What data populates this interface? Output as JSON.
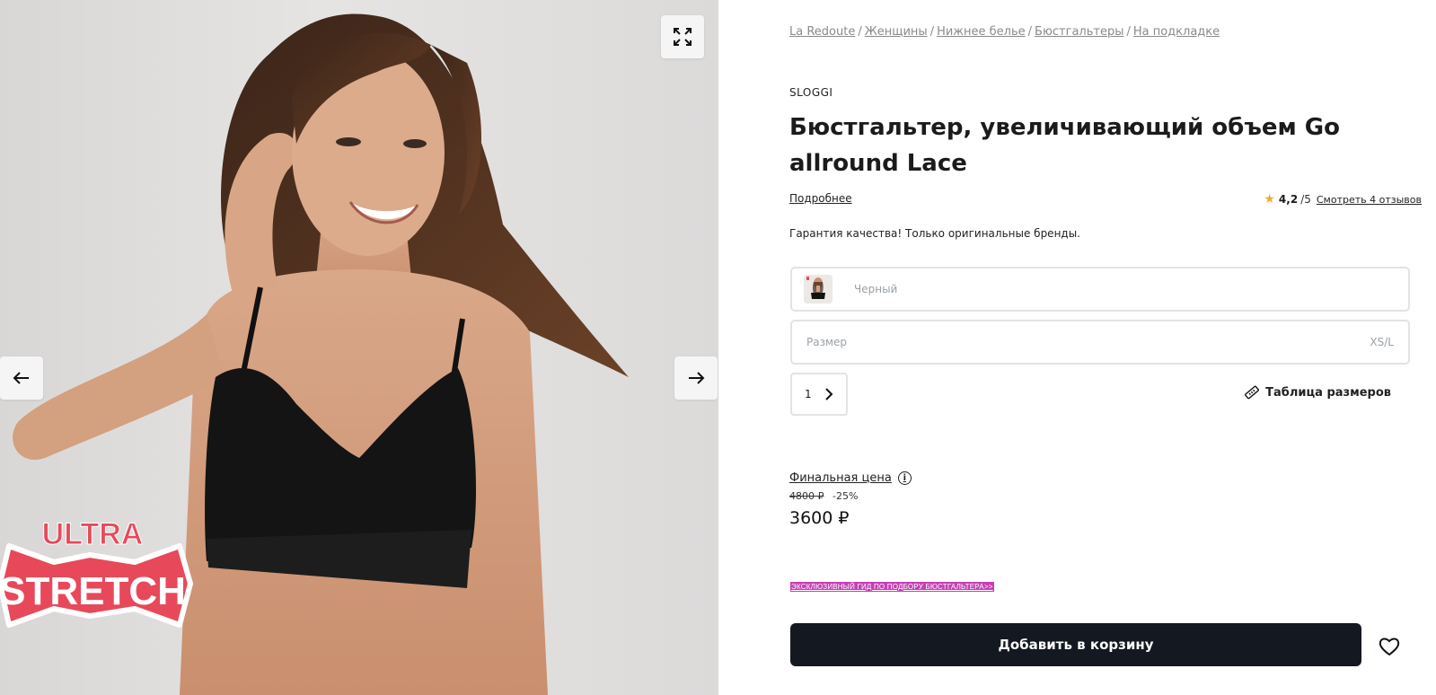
{
  "gallery": {
    "fullscreen_icon": "expand-icon",
    "prev_icon": "arrow-left-icon",
    "next_icon": "arrow-right-icon",
    "badge_line1": "ULTRA",
    "badge_line2": "STRETCH"
  },
  "breadcrumb": {
    "items": [
      "La Redoute",
      "Женщины",
      "Нижнее белье",
      "Бюстгальтеры",
      "На подкладке"
    ],
    "separator": "/"
  },
  "product": {
    "brand": "SLOGGI",
    "title": "Бюстгальтер, увеличивающий объем Go allround Lace",
    "more_link": "Подробнее",
    "rating_score": "4,2",
    "rating_out_of": "/5",
    "reviews_link": "Смотреть 4 отзывов",
    "guarantee": "Гарантия качества! Только оригинальные бренды."
  },
  "options": {
    "color_placeholder": "Черный",
    "size_label": "Размер",
    "size_value": "XS/L",
    "quantity": "1",
    "size_chart_label": "Таблица размеров"
  },
  "pricing": {
    "final_price_label": "Финальная цена",
    "old_price": "4800 ₽",
    "discount": "-25%",
    "price": "3600 ₽"
  },
  "guide_link": "ЭКСКЛЮЗИВНЫЙ ГИД ПО ПОДБОРУ БЮСТГАЛЬТЕРА>>",
  "actions": {
    "add_to_cart": "Добавить в корзину",
    "wishlist_icon": "heart-icon"
  },
  "colors": {
    "accent_dark": "#141821",
    "guide_bg": "#c63fb4",
    "badge_red": "#e8495a",
    "star": "#f2a93b"
  }
}
